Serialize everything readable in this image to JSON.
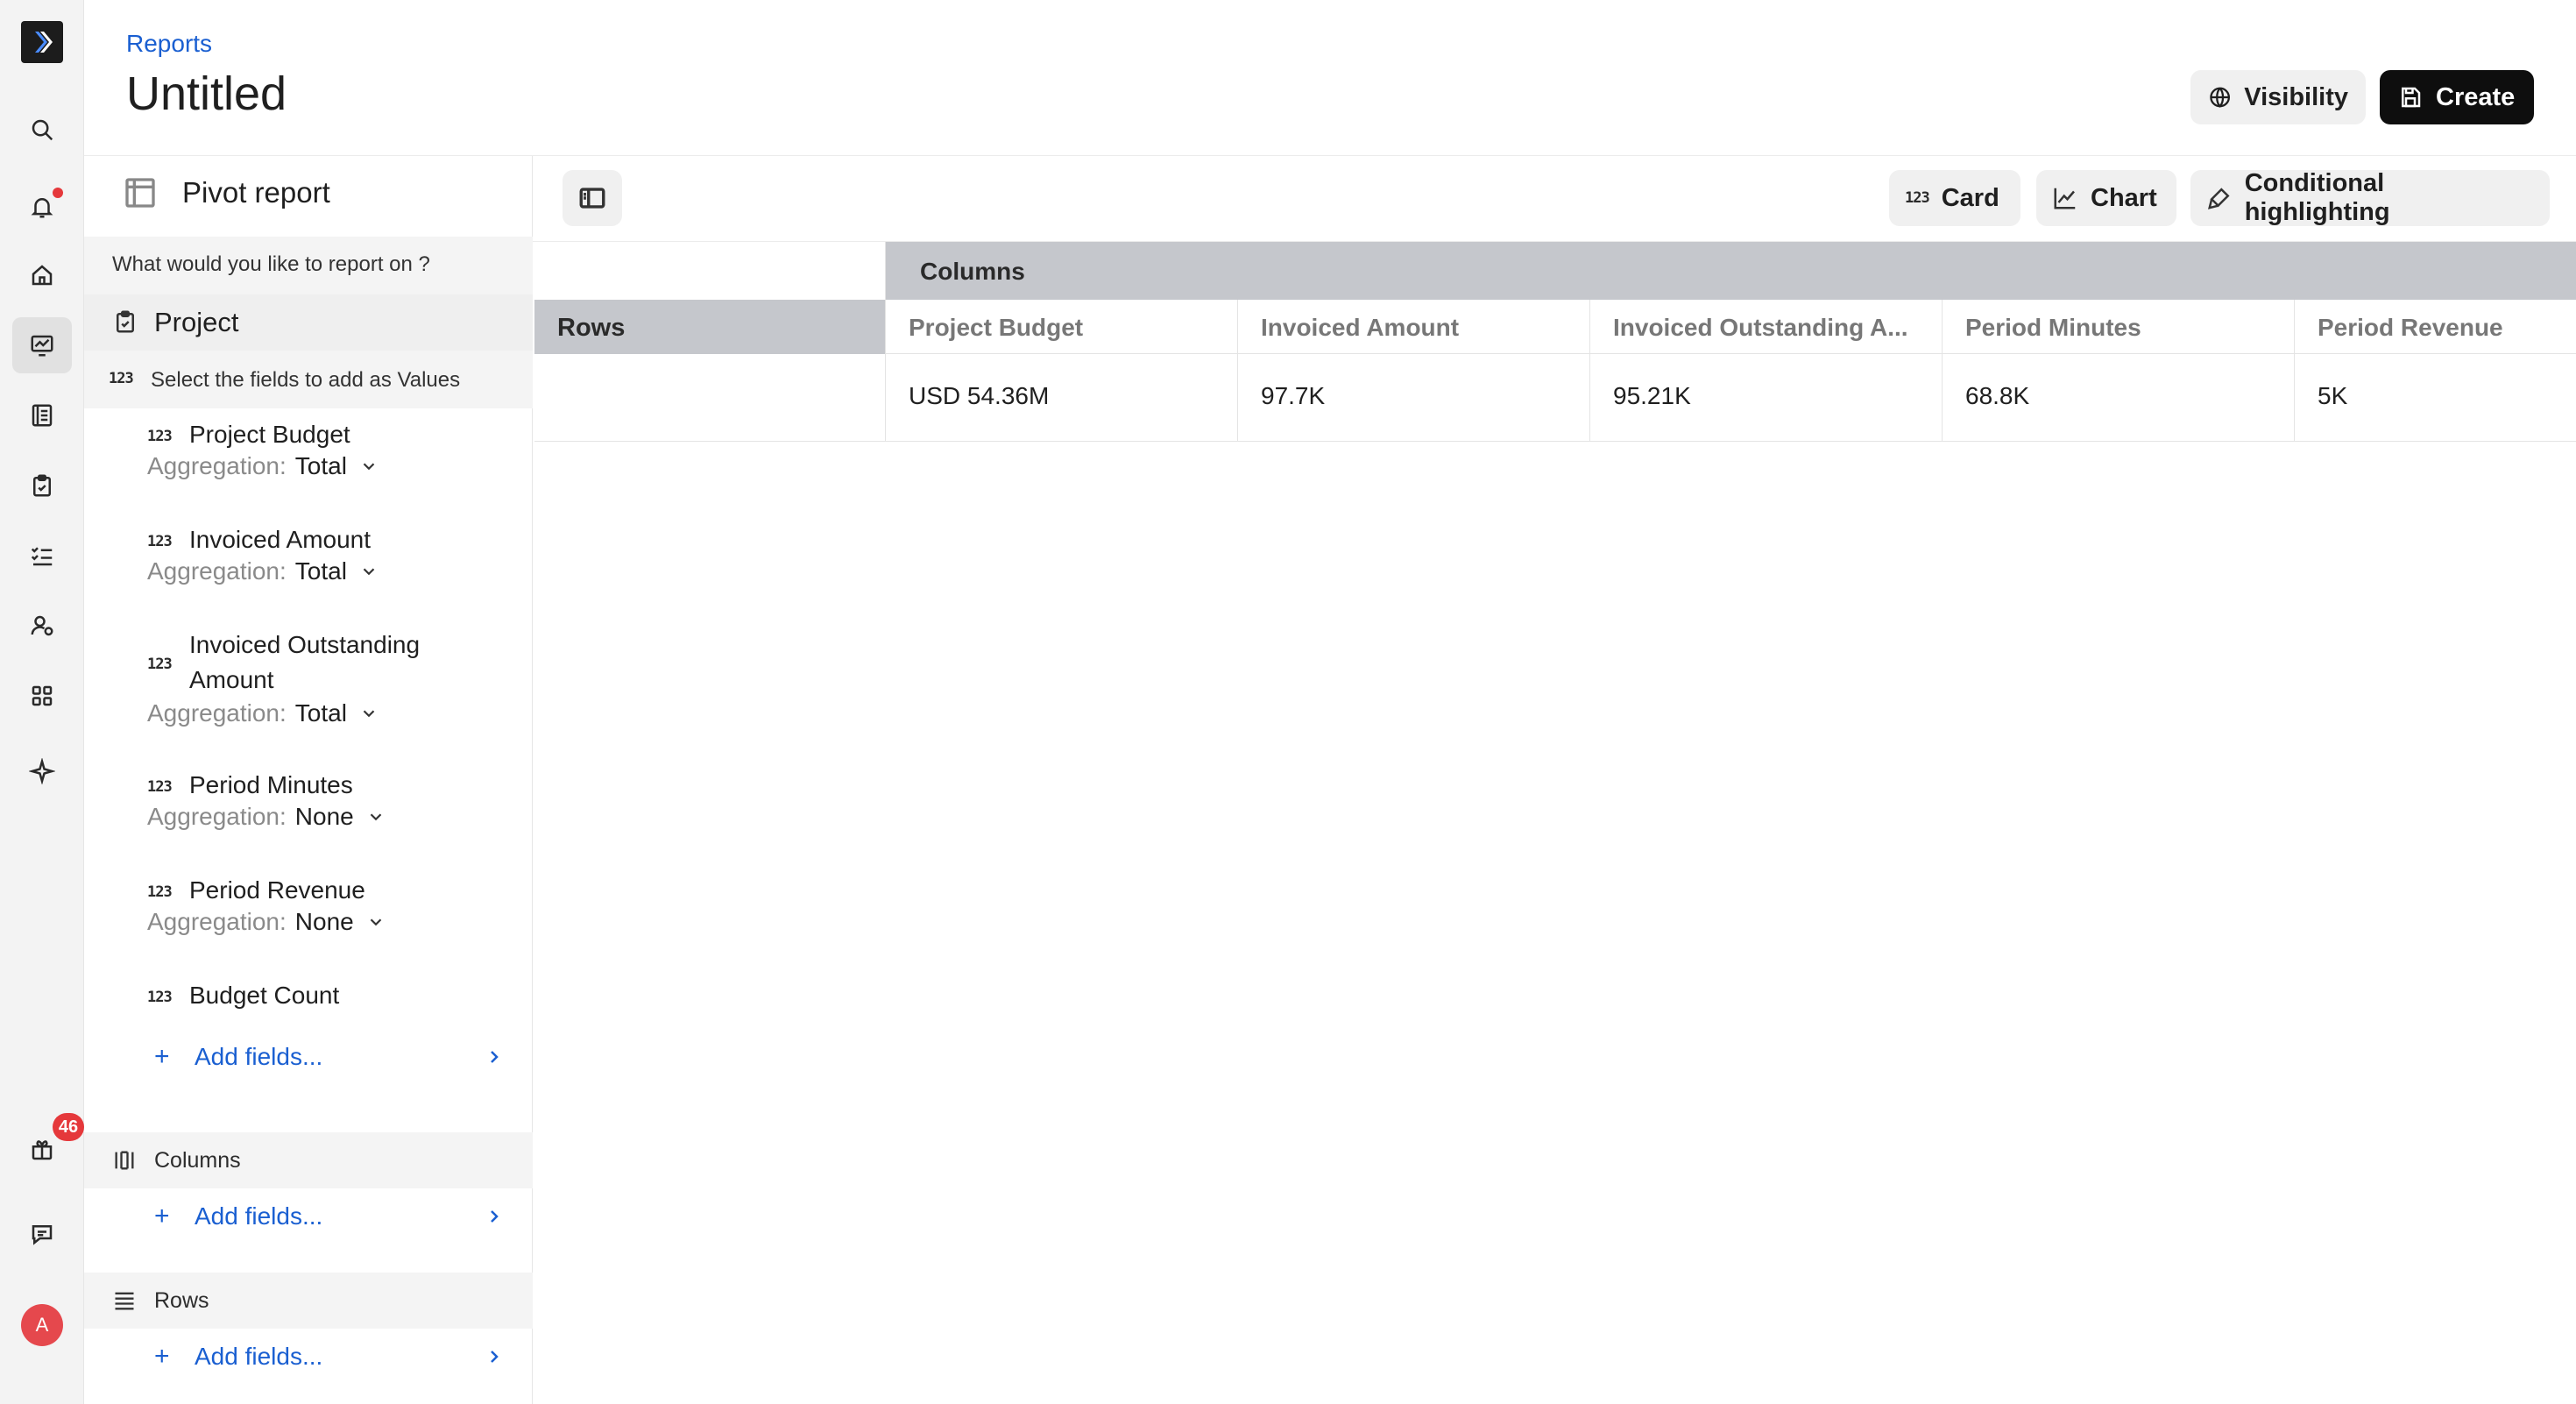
{
  "header": {
    "breadcrumb": "Reports",
    "title": "Untitled",
    "visibility_label": "Visibility",
    "create_label": "Create"
  },
  "rail": {
    "notification_badge": "46",
    "avatar_initial": "A",
    "icons": [
      "search-icon",
      "bell-icon",
      "home-icon",
      "reports-icon",
      "ledger-icon",
      "clipboard-icon",
      "task-list-icon",
      "user-settings-icon",
      "apps-icon",
      "sparkle-icon",
      "gift-icon",
      "chat-icon"
    ]
  },
  "panel": {
    "title": "Pivot report",
    "question": "What would you like to report on ?",
    "entity": "Project",
    "values_hint": "Select the fields to add as Values",
    "number_glyph": "123",
    "aggregation_label": "Aggregation:",
    "fields": [
      {
        "name": "Project Budget",
        "aggregation": "Total"
      },
      {
        "name": "Invoiced Amount",
        "aggregation": "Total"
      },
      {
        "name": "Invoiced Outstanding Amount",
        "aggregation": "Total"
      },
      {
        "name": "Period Minutes",
        "aggregation": "None"
      },
      {
        "name": "Period Revenue",
        "aggregation": "None"
      },
      {
        "name": "Budget Count",
        "aggregation": ""
      }
    ],
    "add_fields": "Add fields...",
    "columns_label": "Columns",
    "rows_label": "Rows"
  },
  "toolbar": {
    "card_label": "Card",
    "chart_label": "Chart",
    "conditional_label": "Conditional highlighting"
  },
  "table": {
    "columns_header": "Columns",
    "rows_header": "Rows",
    "headers": [
      "Project Budget",
      "Invoiced Amount",
      "Invoiced Outstanding A...",
      "Period Minutes",
      "Period Revenue"
    ],
    "values": [
      "USD 54.36M",
      "97.7K",
      "95.21K",
      "68.8K",
      "5K"
    ]
  }
}
